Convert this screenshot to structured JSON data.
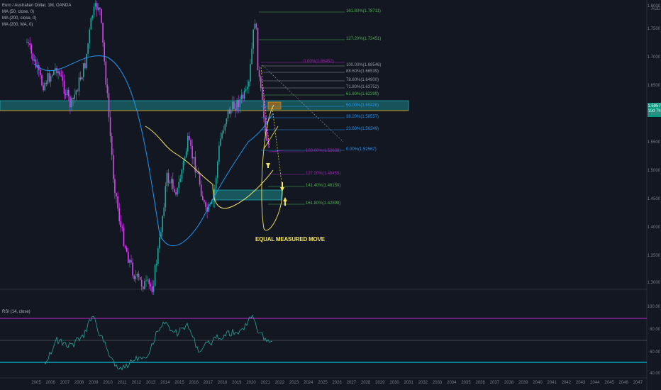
{
  "legend": {
    "symbol": "Euro / Australian Dollar, 1M, OANDA",
    "ma1": "MA (50, close, 0)",
    "ma2": "MA (200, close, 0)",
    "ma3": "MA (200, MA, 0)"
  },
  "rsi_label": "RSI (14, close)",
  "currency": "AUD",
  "current_price": {
    "price": "1.5957",
    "sub": "10d 7h"
  },
  "annotation": "EQUAL MEASURED MOVE",
  "price_axis": [
    "1.8000",
    "1.7500",
    "1.7000",
    "1.6500",
    "1.6000",
    "1.5500",
    "1.5000",
    "1.4500",
    "1.4000",
    "1.3500",
    "1.3000"
  ],
  "rsi_axis": [
    "100.00",
    "80.00",
    "60.00",
    "40.00",
    "20.00"
  ],
  "years": [
    "2005",
    "2006",
    "2007",
    "2008",
    "2009",
    "2010",
    "2011",
    "2012",
    "2013",
    "2014",
    "2015",
    "2016",
    "2017",
    "2018",
    "2019",
    "2020",
    "2021",
    "2022",
    "2023",
    "2024",
    "2025",
    "2026",
    "2027",
    "2028",
    "2029",
    "2030",
    "2031",
    "2032",
    "2033",
    "2034",
    "2035",
    "2036",
    "2037",
    "2038",
    "2039",
    "2040",
    "2041",
    "2042",
    "2043",
    "2044",
    "2045",
    "2046",
    "2047"
  ],
  "fib_upper": [
    {
      "label": "161.80%(1.78711)",
      "color": "#4caf50"
    },
    {
      "label": "127.20%(1.72451)",
      "color": "#4caf50"
    }
  ],
  "fib_main": [
    {
      "label": "0.00%(1.68452)",
      "color": "#9c27b0"
    },
    {
      "label": "100.00%(1.68546)",
      "color": "#9598a1"
    },
    {
      "label": "88.60%(1.66539)",
      "color": "#9598a1"
    },
    {
      "label": "78.60%(1.64900)",
      "color": "#9598a1"
    },
    {
      "label": "71.80%(1.63752)",
      "color": "#9598a1"
    },
    {
      "label": "61.80%(1.62299)",
      "color": "#4caf50"
    },
    {
      "label": "50.00%(1.60426)",
      "color": "#2196f3"
    },
    {
      "label": "38.20%(1.58557)",
      "color": "#2196f3"
    },
    {
      "label": "23.60%(1.56249)",
      "color": "#2196f3"
    },
    {
      "label": "0.00%(1.52567)",
      "color": "#2196f3"
    }
  ],
  "fib_ext": [
    {
      "label": "100.00%(1.52638)",
      "color": "#9c27b0"
    },
    {
      "label": "127.20%(1.48455)",
      "color": "#9c27b0"
    },
    {
      "label": "141.40%(1.46150)",
      "color": "#4caf50"
    },
    {
      "label": "161.80%(1.42898)",
      "color": "#4caf50"
    }
  ],
  "colors": {
    "background": "#131722",
    "up": "#26a69a",
    "down": "#e040fb",
    "ma_blue": "#2196f3",
    "ma_yellow": "#f5e663",
    "zone": "#1a5e63",
    "rsi_line": "#26a69a",
    "rsi_upper": "#9c27b0",
    "rsi_lower": "#00bcd4"
  }
}
